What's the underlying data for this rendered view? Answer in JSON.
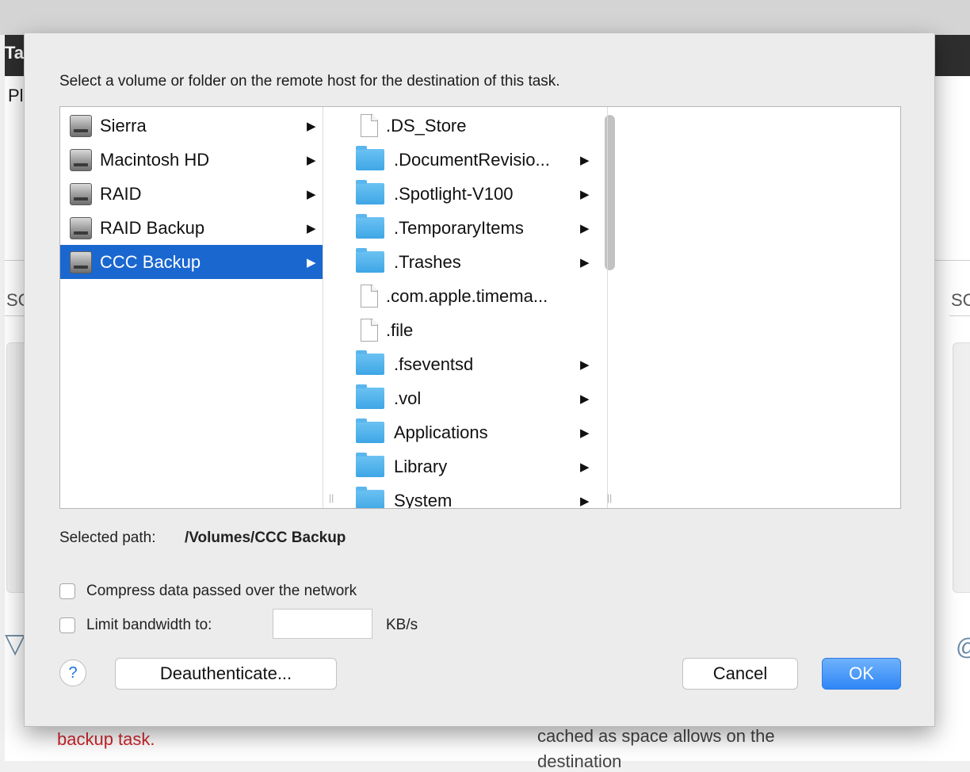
{
  "background": {
    "fragments": {
      "tab_title": "Ta",
      "left_text": "Pl",
      "left_section": "SC",
      "right_section": "SC",
      "red_text": "backup task.",
      "bottom_text_1": "cached as space allows on the",
      "bottom_text_2": "destination"
    }
  },
  "dialog": {
    "instruction": "Select a volume or folder on the remote host for the destination of this task.",
    "volumes": [
      {
        "label": "Sierra",
        "selected": false
      },
      {
        "label": "Macintosh HD",
        "selected": false
      },
      {
        "label": "RAID",
        "selected": false
      },
      {
        "label": "RAID Backup",
        "selected": false
      },
      {
        "label": "CCC Backup",
        "selected": true
      }
    ],
    "items": [
      {
        "label": ".DS_Store",
        "kind": "file"
      },
      {
        "label": ".DocumentRevisio...",
        "kind": "folder"
      },
      {
        "label": ".Spotlight-V100",
        "kind": "folder"
      },
      {
        "label": ".TemporaryItems",
        "kind": "folder"
      },
      {
        "label": ".Trashes",
        "kind": "folder"
      },
      {
        "label": ".com.apple.timema...",
        "kind": "file"
      },
      {
        "label": ".file",
        "kind": "file"
      },
      {
        "label": ".fseventsd",
        "kind": "folder"
      },
      {
        "label": ".vol",
        "kind": "folder"
      },
      {
        "label": "Applications",
        "kind": "folder"
      },
      {
        "label": "Library",
        "kind": "folder"
      },
      {
        "label": "System",
        "kind": "folder"
      }
    ],
    "arrow_glyph": "▶",
    "selected_path_label": "Selected path:",
    "selected_path_value": "/Volumes/CCC Backup",
    "compress_label": "Compress data passed over the network",
    "compress_checked": false,
    "limit_label": "Limit bandwidth to:",
    "limit_checked": false,
    "limit_value": "",
    "limit_unit": "KB/s",
    "help_glyph": "?",
    "deauth_label": "Deauthenticate...",
    "cancel_label": "Cancel",
    "ok_label": "OK",
    "colors": {
      "selection": "#1a67d0",
      "folder": "#3ea6e6",
      "primary_button": "#2f86f6"
    }
  }
}
